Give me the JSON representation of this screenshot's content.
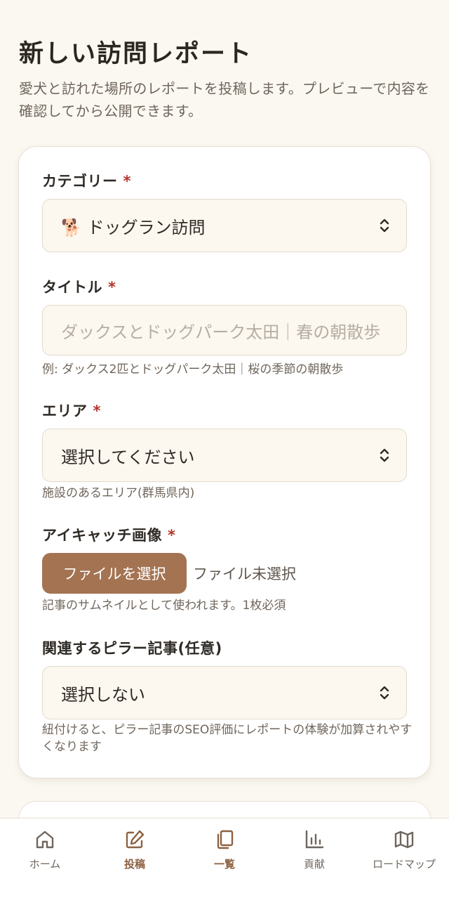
{
  "header": {
    "title": "新しい訪問レポート",
    "description": "愛犬と訪れた場所のレポートを投稿します。プレビューで内容を確認してから公開できます。"
  },
  "form": {
    "required_mark": "*",
    "category": {
      "label": "カテゴリー",
      "value": "🐕 ドッグラン訪問"
    },
    "title": {
      "label": "タイトル",
      "placeholder": "ダックスとドッグパーク太田｜春の朝散歩",
      "hint": "例: ダックス2匹とドッグパーク太田｜桜の季節の朝散歩"
    },
    "area": {
      "label": "エリア",
      "value": "選択してください",
      "hint": "施設のあるエリア(群馬県内)"
    },
    "eyecatch": {
      "label": "アイキャッチ画像",
      "button": "ファイルを選択",
      "status": "ファイル未選択",
      "hint": "記事のサムネイルとして使われます。1枚必須"
    },
    "pillar": {
      "label": "関連するピラー記事(任意)",
      "value": "選択しない",
      "hint": "紐付けると、ピラー記事のSEO評価にレポートの体験が加算されやすくなります"
    }
  },
  "nav": {
    "items": [
      {
        "label": "ホーム",
        "icon": "home-icon"
      },
      {
        "label": "投稿",
        "icon": "edit-icon"
      },
      {
        "label": "一覧",
        "icon": "documents-icon"
      },
      {
        "label": "貢献",
        "icon": "chart-icon"
      },
      {
        "label": "ロードマップ",
        "icon": "map-icon"
      }
    ],
    "active_color": "#8d6141",
    "inactive_color": "#6e665e"
  },
  "colors": {
    "accent": "#a47352",
    "required": "#b3352b",
    "background": "#fbf8f2"
  }
}
